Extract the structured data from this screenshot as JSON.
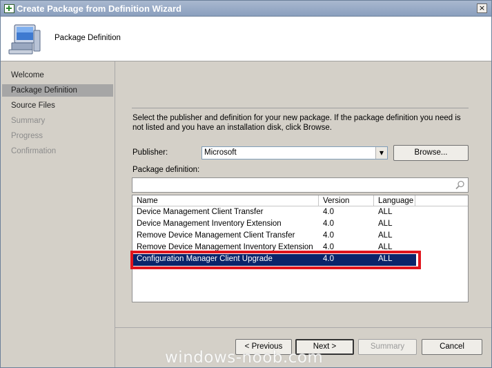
{
  "window": {
    "title": "Create Package from Definition Wizard",
    "close_glyph": "×"
  },
  "header": {
    "title": "Package Definition",
    "icon": "computer-monitor-icon"
  },
  "nav": {
    "items": [
      {
        "label": "Welcome",
        "state": "normal"
      },
      {
        "label": "Package Definition",
        "state": "selected"
      },
      {
        "label": "Source Files",
        "state": "normal"
      },
      {
        "label": "Summary",
        "state": "disabled"
      },
      {
        "label": "Progress",
        "state": "disabled"
      },
      {
        "label": "Confirmation",
        "state": "disabled"
      }
    ]
  },
  "main": {
    "description": "Select the publisher and definition for your new package. If the package definition you need is not listed and you have an installation disk, click Browse.",
    "publisher_label": "Publisher:",
    "publisher_value": "Microsoft",
    "browse_label": "Browse...",
    "definition_label": "Package definition:",
    "search_value": "",
    "table": {
      "columns": [
        "Name",
        "Version",
        "Language"
      ],
      "rows": [
        [
          "Device Management Client Transfer",
          "4.0",
          "ALL"
        ],
        [
          "Device Management Inventory Extension",
          "4.0",
          "ALL"
        ],
        [
          "Remove Device Management Client Transfer",
          "4.0",
          "ALL"
        ],
        [
          "Remove Device Management Inventory Extension",
          "4.0",
          "ALL"
        ],
        [
          "Configuration Manager Client Upgrade",
          "4.0",
          "ALL"
        ]
      ],
      "selected_row": 4
    }
  },
  "footer": {
    "previous_label": "< Previous",
    "next_label": "Next >",
    "summary_label": "Summary",
    "cancel_label": "Cancel"
  },
  "watermark": "windows-noob.com",
  "colors": {
    "highlight_box": "#e0141c",
    "selection": "#0a246a",
    "titlebar": "#8a9fbe"
  }
}
